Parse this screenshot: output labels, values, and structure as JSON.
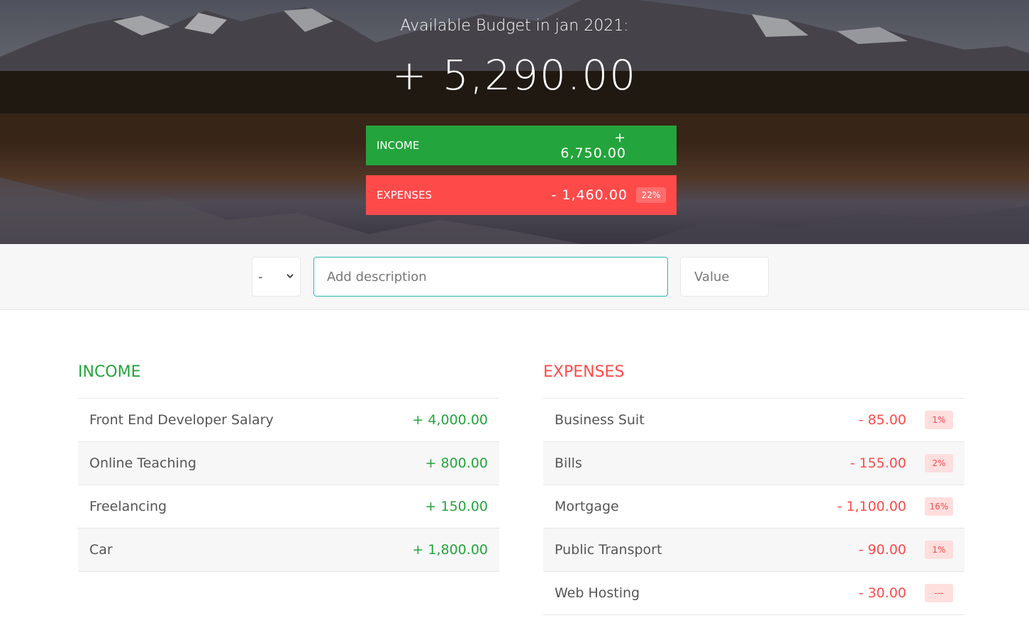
{
  "header": {
    "title": "Available Budget in jan 2021:",
    "budget": "+ 5,290.00",
    "income": {
      "label": "Income",
      "value": "+ 6,750.00"
    },
    "expenses": {
      "label": "Expenses",
      "value": "- 1,460.00",
      "percentage": "22%"
    }
  },
  "add": {
    "type_selected": "-",
    "description_placeholder": "Add description",
    "value_placeholder": "Value"
  },
  "income": {
    "title": "Income",
    "items": [
      {
        "description": "Front End Developer Salary",
        "value": "+ 4,000.00"
      },
      {
        "description": "Online Teaching",
        "value": "+ 800.00"
      },
      {
        "description": "Freelancing",
        "value": "+ 150.00"
      },
      {
        "description": "Car",
        "value": "+ 1,800.00"
      }
    ]
  },
  "expenses": {
    "title": "Expenses",
    "items": [
      {
        "description": "Business Suit",
        "value": "- 85.00",
        "percentage": "1%"
      },
      {
        "description": "Bills",
        "value": "- 155.00",
        "percentage": "2%"
      },
      {
        "description": "Mortgage",
        "value": "- 1,100.00",
        "percentage": "16%"
      },
      {
        "description": "Public Transport",
        "value": "- 90.00",
        "percentage": "1%"
      },
      {
        "description": "Web Hosting",
        "value": "- 30.00",
        "percentage": "---"
      }
    ]
  },
  "colors": {
    "income": "#24a43c",
    "expenses": "#ff4a4a",
    "focus_border": "#28b9b5"
  }
}
